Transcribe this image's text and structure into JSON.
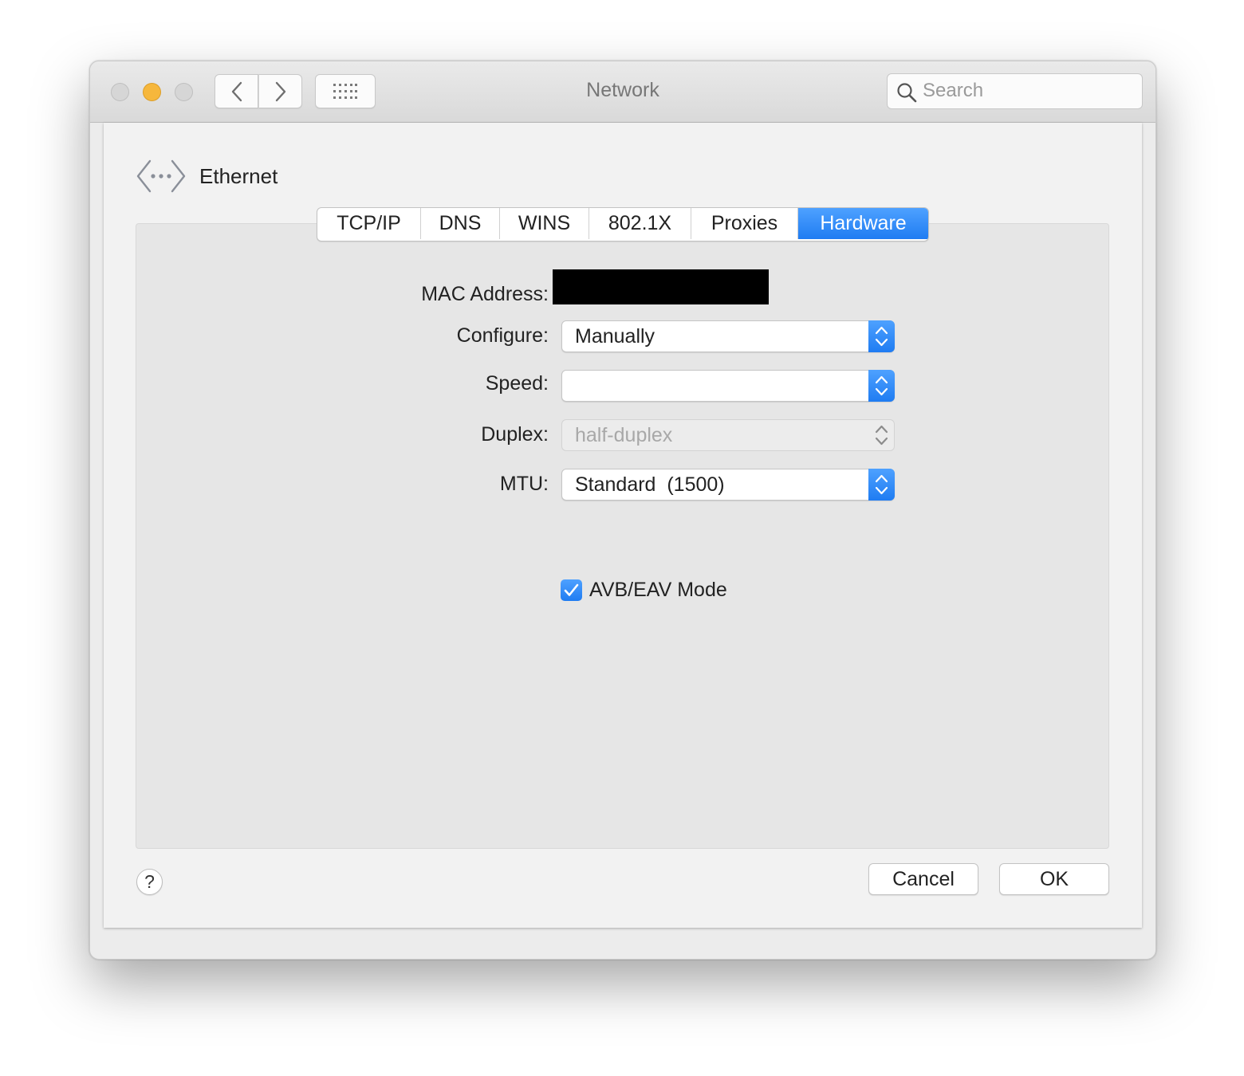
{
  "window": {
    "title": "Network"
  },
  "search": {
    "placeholder": "Search",
    "value": ""
  },
  "interface": {
    "name": "Ethernet",
    "icon": "ethernet-icon"
  },
  "tabs": [
    {
      "label": "TCP/IP",
      "active": false
    },
    {
      "label": "DNS",
      "active": false
    },
    {
      "label": "WINS",
      "active": false
    },
    {
      "label": "802.1X",
      "active": false
    },
    {
      "label": "Proxies",
      "active": false
    },
    {
      "label": "Hardware",
      "active": true
    }
  ],
  "hardware": {
    "mac_label": "MAC Address:",
    "configure_label": "Configure:",
    "configure_value": "Manually",
    "speed_label": "Speed:",
    "speed_value": "",
    "duplex_label": "Duplex:",
    "duplex_value": "half-duplex",
    "mtu_label": "MTU:",
    "mtu_value": "Standard  (1500)",
    "avb_label": "AVB/EAV Mode",
    "avb_checked": true
  },
  "footer": {
    "help_label": "?",
    "cancel_label": "Cancel",
    "ok_label": "OK"
  },
  "colors": {
    "accent": "#1f7cf2",
    "minimize": "#f6b73c",
    "inactive_light": "#d6d6d6"
  }
}
